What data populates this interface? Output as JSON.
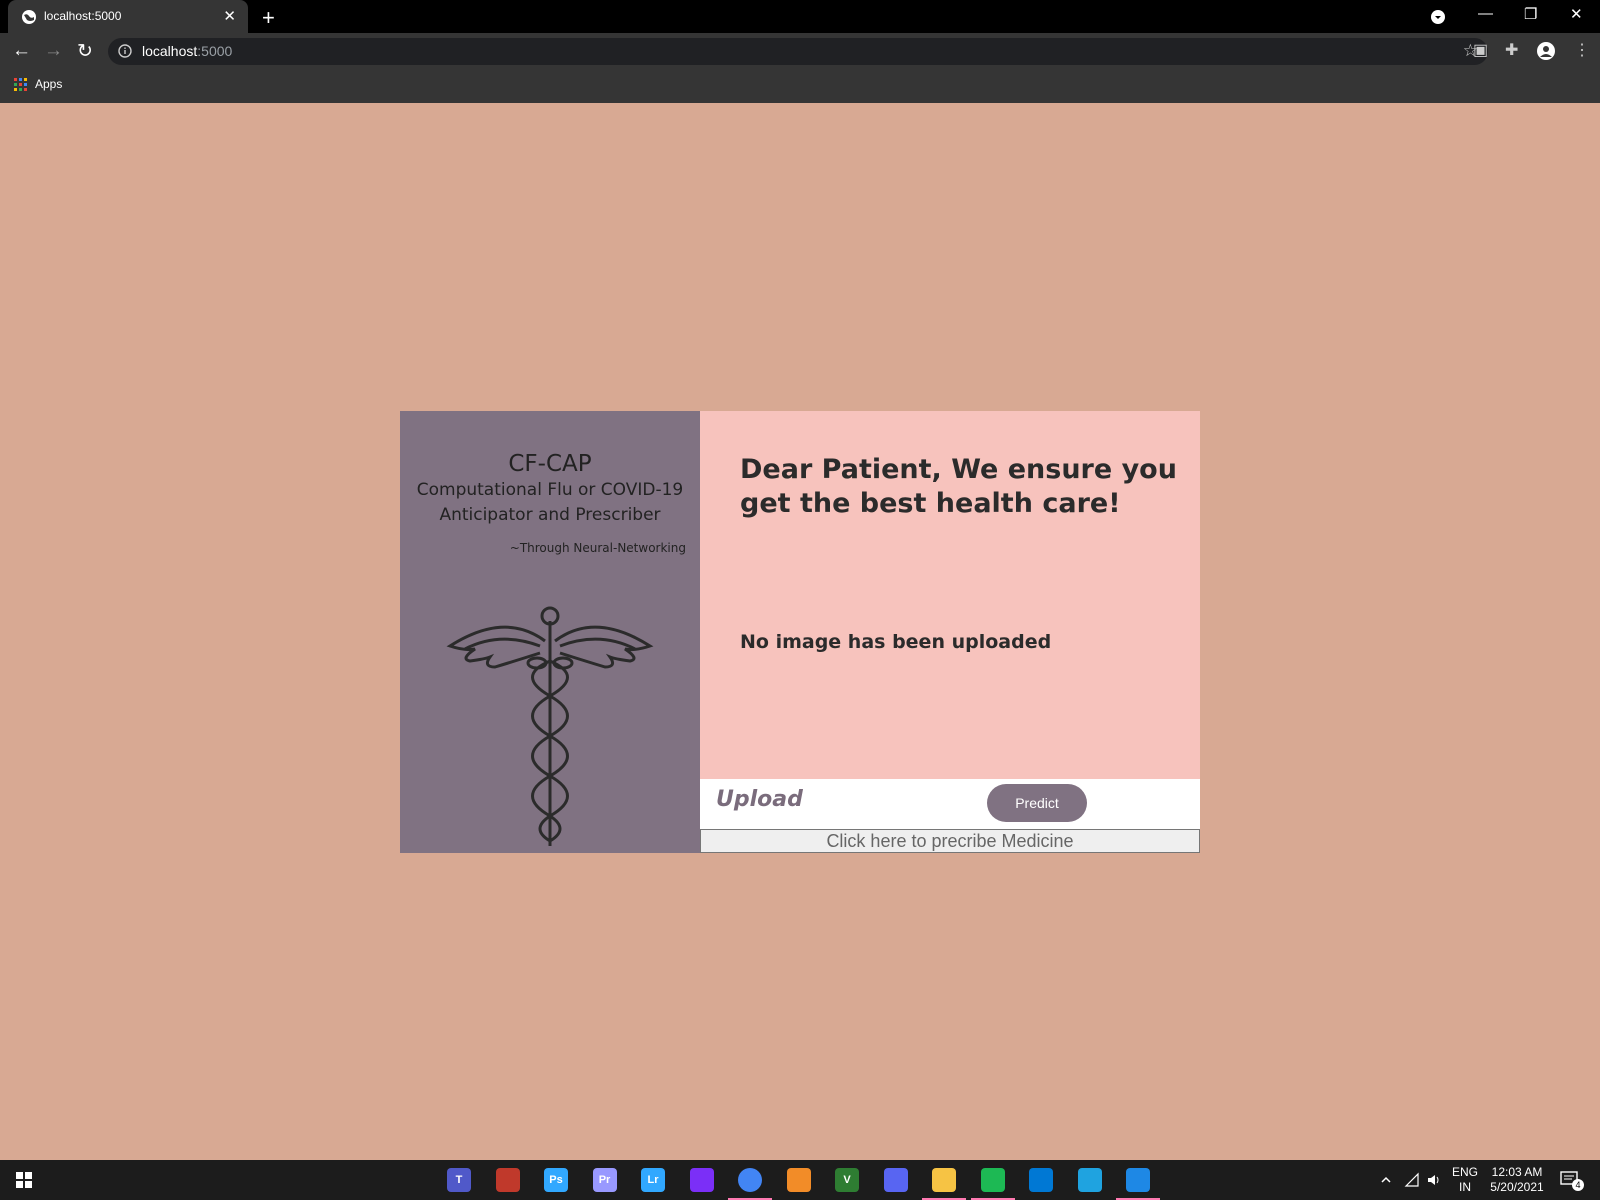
{
  "browser": {
    "tab_title": "localhost:5000",
    "url_host": "localhost",
    "url_port": ":5000",
    "bookmark_apps_label": "Apps"
  },
  "page": {
    "brand_name": "CF-CAP",
    "brand_subtitle_line1": "Computational Flu or COVID-19",
    "brand_subtitle_line2": "Anticipator and Prescriber",
    "tagline": "~Through Neural-Networking",
    "heading": "Dear Patient, We ensure you get the best health care!",
    "status_text": "No image has been uploaded",
    "upload_label": "Upload",
    "predict_label": "Predict",
    "prescribe_label": "Click here to precribe Medicine"
  },
  "taskbar": {
    "apps": [
      {
        "name": "teams-icon",
        "label": "T",
        "color": "#5059c9"
      },
      {
        "name": "speedometer-icon",
        "label": "",
        "color": "#c0392b"
      },
      {
        "name": "photoshop-icon",
        "label": "Ps",
        "color": "#31a8ff"
      },
      {
        "name": "premiere-icon",
        "label": "Pr",
        "color": "#9999ff"
      },
      {
        "name": "lightroom-icon",
        "label": "Lr",
        "color": "#31a8ff"
      },
      {
        "name": "podcast-icon",
        "label": "",
        "color": "#7b2ff7"
      },
      {
        "name": "chrome-icon",
        "label": "",
        "color": "#4285f4"
      },
      {
        "name": "eclipse-icon",
        "label": "",
        "color": "#f28c28"
      },
      {
        "name": "vim-icon",
        "label": "V",
        "color": "#2e7d32"
      },
      {
        "name": "discord-icon",
        "label": "",
        "color": "#5865f2"
      },
      {
        "name": "file-explorer-icon",
        "label": "",
        "color": "#f6c344"
      },
      {
        "name": "spotify-icon",
        "label": "",
        "color": "#1db954"
      },
      {
        "name": "vscode-icon",
        "label": "",
        "color": "#0078d4"
      },
      {
        "name": "edge-icon",
        "label": "",
        "color": "#1fa3e0"
      },
      {
        "name": "video-editor-icon",
        "label": "",
        "color": "#1e88e5"
      }
    ],
    "lang_line1": "ENG",
    "lang_line2": "IN",
    "time": "12:03 AM",
    "date": "5/20/2021",
    "notification_count": "4"
  }
}
